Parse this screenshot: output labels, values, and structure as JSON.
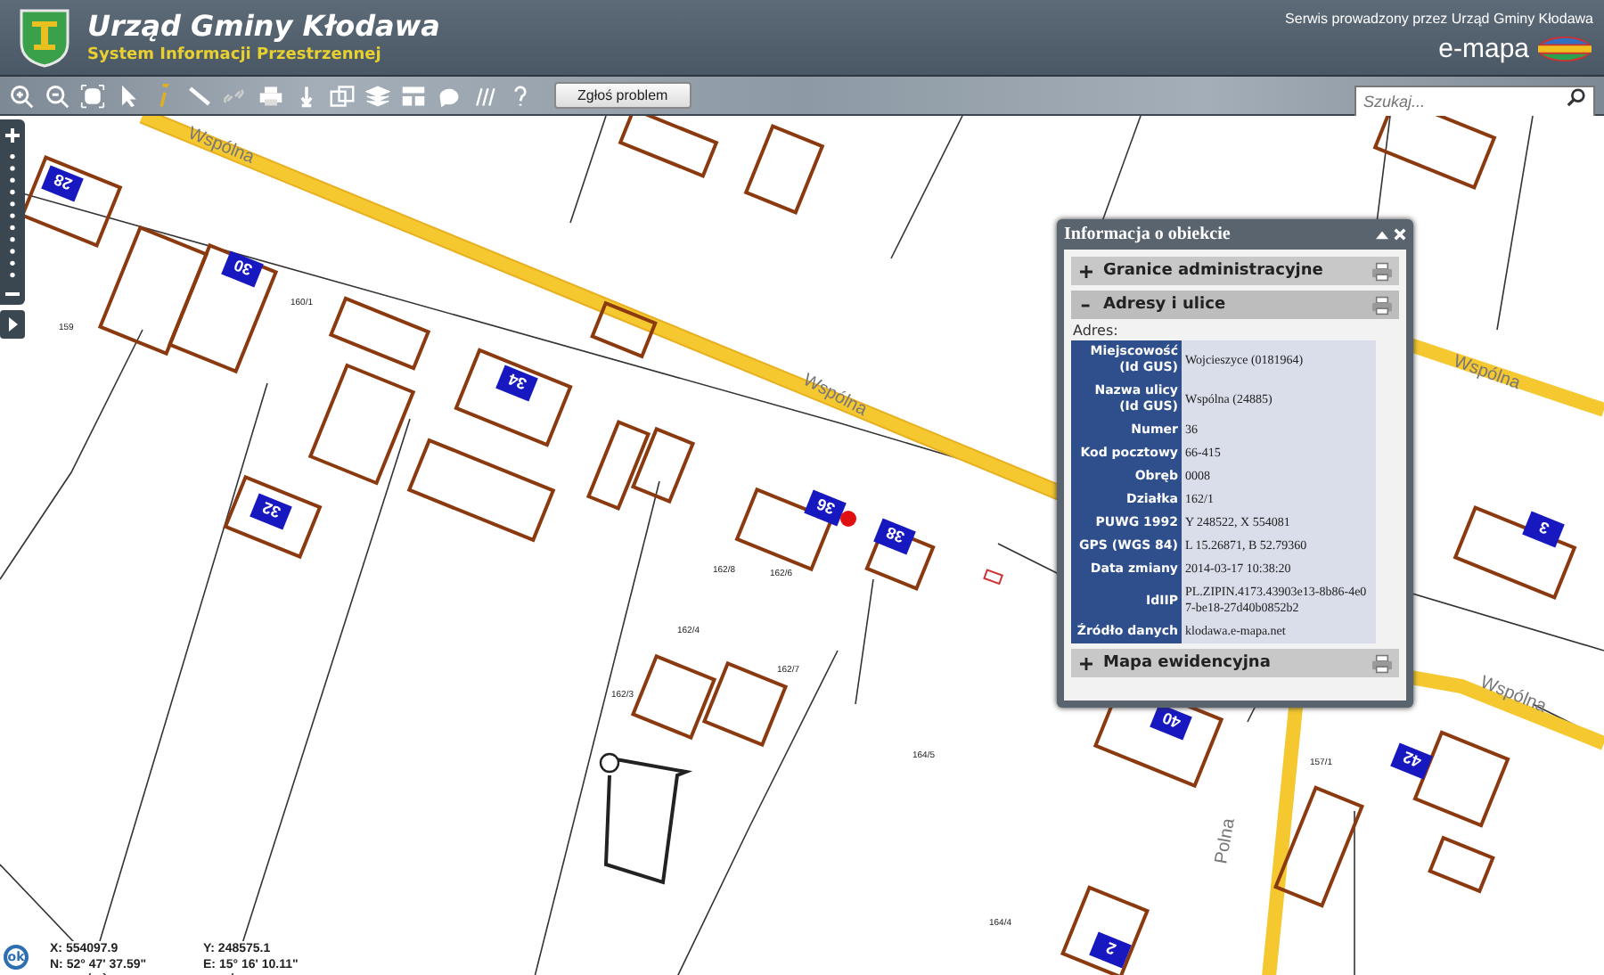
{
  "header": {
    "title": "Urząd Gminy Kłodawa",
    "subtitle": "System Informacji Przestrzennej",
    "operator_note": "Serwis prowadzony przez Urząd Gminy Kłodawa",
    "brand": "e-mapa"
  },
  "toolbar": {
    "report_button": "Zgłoś problem",
    "search": {
      "placeholder": "Szukaj..."
    }
  },
  "map": {
    "streets": [
      {
        "name": "Wspólna"
      },
      {
        "name": "Wspólna"
      },
      {
        "name": "Wspólna"
      },
      {
        "name": "Wspólna"
      },
      {
        "name": "Polna"
      }
    ],
    "house_numbers": [
      "28",
      "30",
      "34",
      "32",
      "36",
      "38",
      "40",
      "42",
      "3",
      "2"
    ],
    "parcels": [
      "159",
      "160/1",
      "162/6",
      "162/4",
      "162/3",
      "162/7",
      "164/5",
      "164/4",
      "157/1",
      "162/8"
    ]
  },
  "info_panel": {
    "title": "Informacja o obiekcie",
    "sections": [
      {
        "title": "Granice administracyjne",
        "expanded": false
      },
      {
        "title": "Adresy i ulice",
        "expanded": true,
        "caption": "Adres:",
        "rows": [
          {
            "label": "Miejscowość (Id GUS)",
            "value": "Wojcieszyce (0181964)"
          },
          {
            "label": "Nazwa ulicy (Id GUS)",
            "value": "Wspólna (24885)"
          },
          {
            "label": "Numer",
            "value": "36"
          },
          {
            "label": "Kod pocztowy",
            "value": "66-415"
          },
          {
            "label": "Obręb",
            "value": "0008"
          },
          {
            "label": "Działka",
            "value": "162/1"
          },
          {
            "label": "PUWG 1992",
            "value": "Y 248522, X 554081"
          },
          {
            "label": "GPS (WGS 84)",
            "value": "L 15.26871, B 52.79360"
          },
          {
            "label": "Data zmiany",
            "value": "2014-03-17 10:38:20"
          },
          {
            "label": "IdIIP",
            "value": "PL.ZIPIN.4173.43903e13-8b86-4e07-be18-27d40b0852b2"
          },
          {
            "label": "Źródło danych",
            "value": "klodawa.e-mapa.net"
          }
        ]
      },
      {
        "title": "Mapa ewidencyjna",
        "expanded": false
      }
    ]
  },
  "coordinates": {
    "ok": "ok",
    "x": "X: 554097.9",
    "y": "Y: 248575.1",
    "n": "N: 52° 47' 37.59\"",
    "e": "E: 15° 16' 10.11\""
  }
}
